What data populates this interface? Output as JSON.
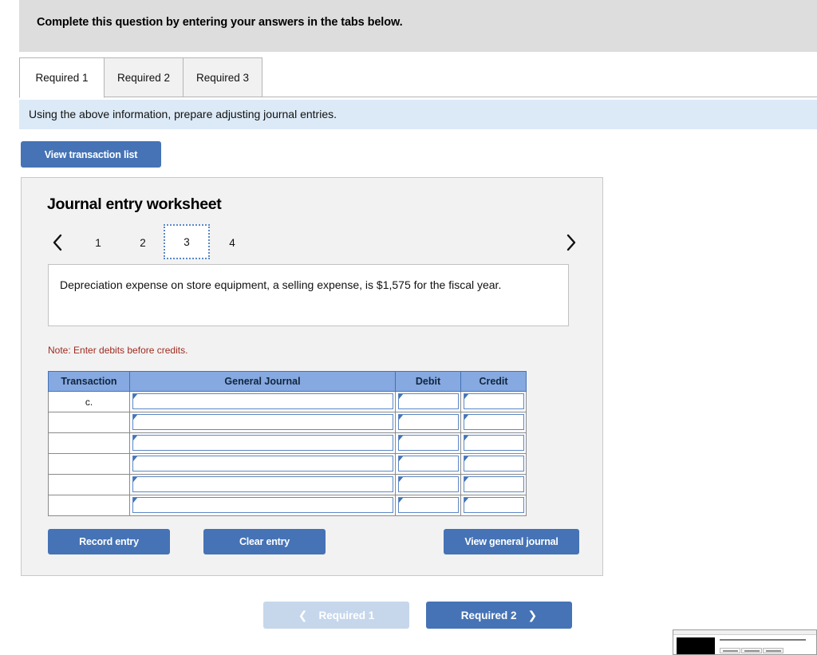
{
  "banner": {
    "text": "Complete this question by entering your answers in the tabs below."
  },
  "tabs": {
    "active_index": 0,
    "items": [
      {
        "label": "Required 1"
      },
      {
        "label": "Required 2"
      },
      {
        "label": "Required 3"
      }
    ]
  },
  "info_bar": {
    "text": "Using the above information, prepare adjusting journal entries."
  },
  "toolbar": {
    "view_transaction_list_label": "View transaction list"
  },
  "worksheet": {
    "title": "Journal entry worksheet",
    "pager": {
      "prev_icon": "chevron-left-icon",
      "next_icon": "chevron-right-icon",
      "pages": [
        "1",
        "2",
        "3",
        "4"
      ],
      "current_page": "3"
    },
    "question": "Depreciation expense on store equipment, a selling expense, is $1,575 for the fiscal year.",
    "note": "Note: Enter debits before credits.",
    "table": {
      "headers": [
        "Transaction",
        "General Journal",
        "Debit",
        "Credit"
      ],
      "rows": [
        {
          "transaction": "c.",
          "general_journal": "",
          "debit": "",
          "credit": ""
        },
        {
          "transaction": "",
          "general_journal": "",
          "debit": "",
          "credit": ""
        },
        {
          "transaction": "",
          "general_journal": "",
          "debit": "",
          "credit": ""
        },
        {
          "transaction": "",
          "general_journal": "",
          "debit": "",
          "credit": ""
        },
        {
          "transaction": "",
          "general_journal": "",
          "debit": "",
          "credit": ""
        },
        {
          "transaction": "",
          "general_journal": "",
          "debit": "",
          "credit": ""
        }
      ]
    },
    "actions": {
      "record_entry_label": "Record entry",
      "clear_entry_label": "Clear entry",
      "view_general_journal_label": "View general journal"
    }
  },
  "bottom_nav": {
    "prev_label": "Required 1",
    "prev_icon": "chevron-left-icon",
    "prev_disabled": true,
    "next_label": "Required 2",
    "next_icon": "chevron-right-icon"
  },
  "colors": {
    "banner_gray": "#dddddd",
    "info_blue": "#dce9f7",
    "button_blue": "#4573b5",
    "button_blue_disabled": "#c6d7ec",
    "table_header_blue": "#85a9e0",
    "note_red": "#9e2b20",
    "panel_gray": "#f2f2f2"
  }
}
